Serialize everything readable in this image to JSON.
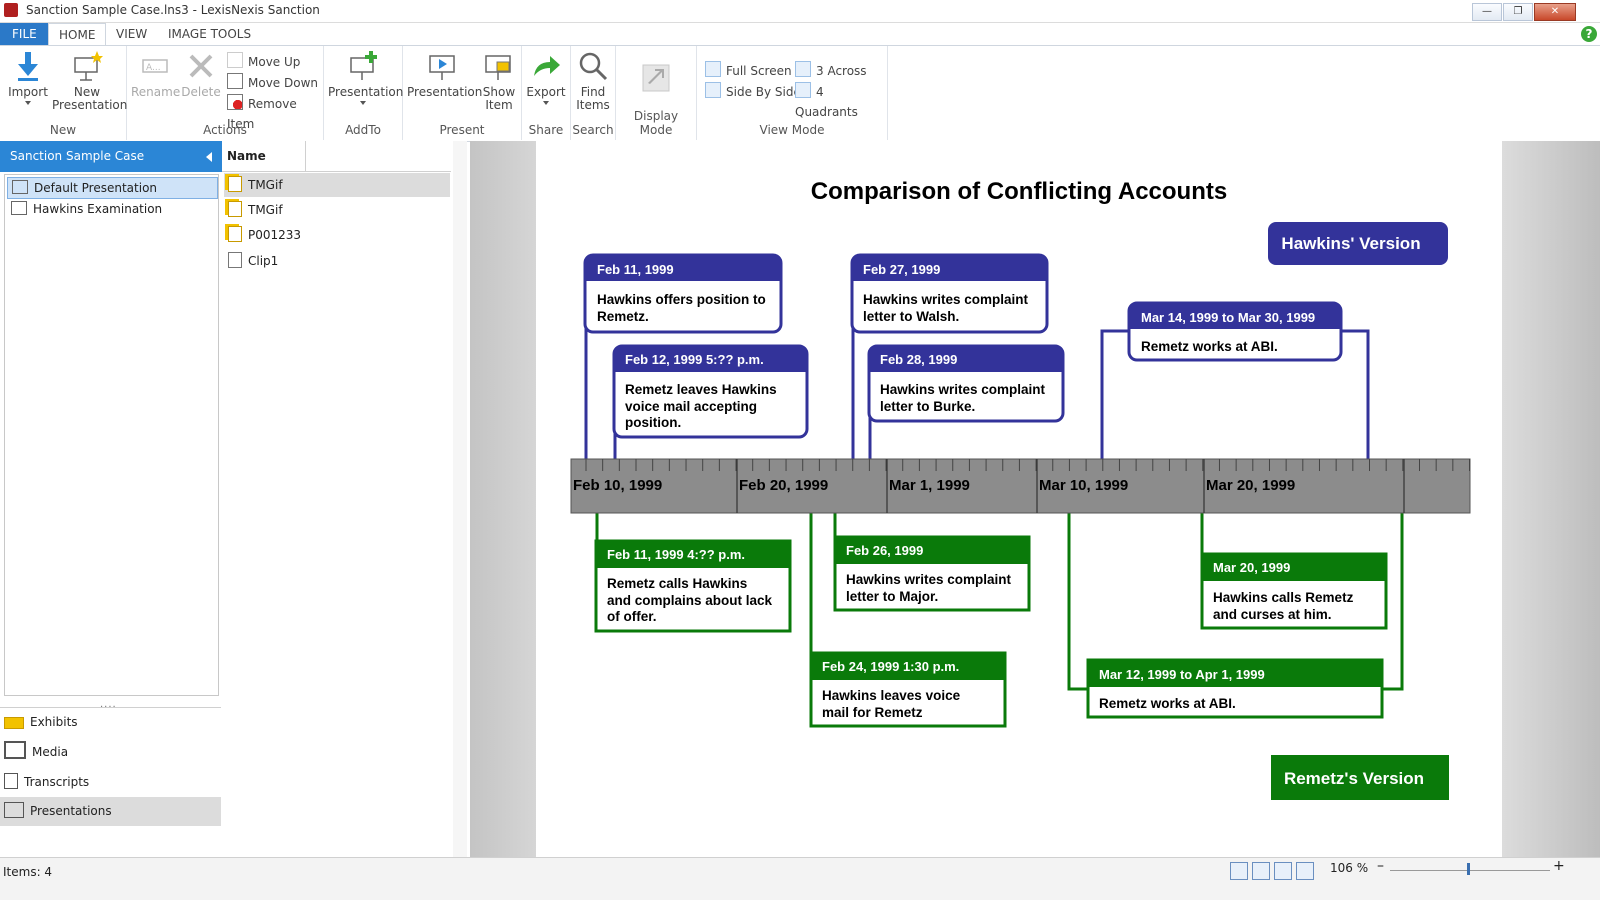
{
  "window": {
    "title": "Sanction Sample Case.lns3 - LexisNexis Sanction"
  },
  "tabs": [
    "FILE",
    "HOME",
    "VIEW",
    "IMAGE TOOLS"
  ],
  "ribbon": {
    "import": "Import",
    "new_presentation": [
      "New",
      "Presentation"
    ],
    "rename": "Rename",
    "delete": "Delete",
    "move_up": "Move Up",
    "move_down": "Move Down",
    "remove_item": "Remove Item",
    "addto_presentation": "Presentation",
    "present_presentation": "Presentation",
    "show_item": [
      "Show",
      "Item"
    ],
    "export": "Export",
    "find_items": [
      "Find",
      "Items"
    ],
    "full_screen": "Full Screen",
    "side_by_side": "Side By Side",
    "three_across": "3 Across",
    "four_quadrants": "4 Quadrants",
    "groups": {
      "new": "New",
      "actions": "Actions",
      "addto": "AddTo",
      "present": "Present",
      "share": "Share",
      "search": "Search",
      "display_mode": "Display Mode",
      "view_mode": "View Mode"
    }
  },
  "left_panel": {
    "case_name": "Sanction Sample Case",
    "presentations": [
      "Default Presentation",
      "Hawkins Examination"
    ],
    "nav": [
      "Exhibits",
      "Media",
      "Transcripts",
      "Presentations"
    ]
  },
  "items_panel": {
    "header": "Name",
    "items": [
      "TMGif",
      "TMGif",
      "P001233",
      "Clip1"
    ]
  },
  "slide": {
    "title": "Comparison of Conflicting Accounts",
    "hawkins_label": "Hawkins' Version",
    "remetz_label": "Remetz's Version",
    "axis_labels": [
      "Feb 10, 1999",
      "Feb 20, 1999",
      "Mar 1, 1999",
      "Mar 10, 1999",
      "Mar 20, 1999"
    ],
    "hawkins_events": [
      {
        "date": "Feb 11, 1999",
        "text": [
          "Hawkins offers position to",
          "Remetz."
        ]
      },
      {
        "date": "Feb 12, 1999 5:?? p.m.",
        "text": [
          "Remetz leaves Hawkins",
          "voice mail accepting",
          "position."
        ]
      },
      {
        "date": "Feb 27, 1999",
        "text": [
          "Hawkins writes complaint",
          "letter to Walsh."
        ]
      },
      {
        "date": "Feb 28, 1999",
        "text": [
          "Hawkins writes complaint",
          "letter to Burke."
        ]
      },
      {
        "date": "Mar 14, 1999 to Mar 30, 1999",
        "text": [
          "Remetz works at ABI."
        ]
      }
    ],
    "remetz_events": [
      {
        "date": "Feb 11, 1999 4:?? p.m.",
        "text": [
          "Remetz calls Hawkins",
          "and complains about lack",
          "of offer."
        ]
      },
      {
        "date": "Feb 26, 1999",
        "text": [
          "Hawkins writes complaint",
          "letter to Major."
        ]
      },
      {
        "date": "Feb 24, 1999 1:30 p.m.",
        "text": [
          "Hawkins leaves voice",
          "mail for Remetz"
        ]
      },
      {
        "date": "Mar 20, 1999",
        "text": [
          "Hawkins calls Remetz",
          "and curses at him."
        ]
      },
      {
        "date": "Mar 12, 1999 to Apr 1, 1999",
        "text": [
          "Remetz works at ABI."
        ]
      }
    ],
    "colors": {
      "hawkins": "#33339a",
      "remetz": "#0a7a0a",
      "axis": "#8c8c8c"
    }
  },
  "status": {
    "items": "Items: 4",
    "zoom": "106 %"
  }
}
